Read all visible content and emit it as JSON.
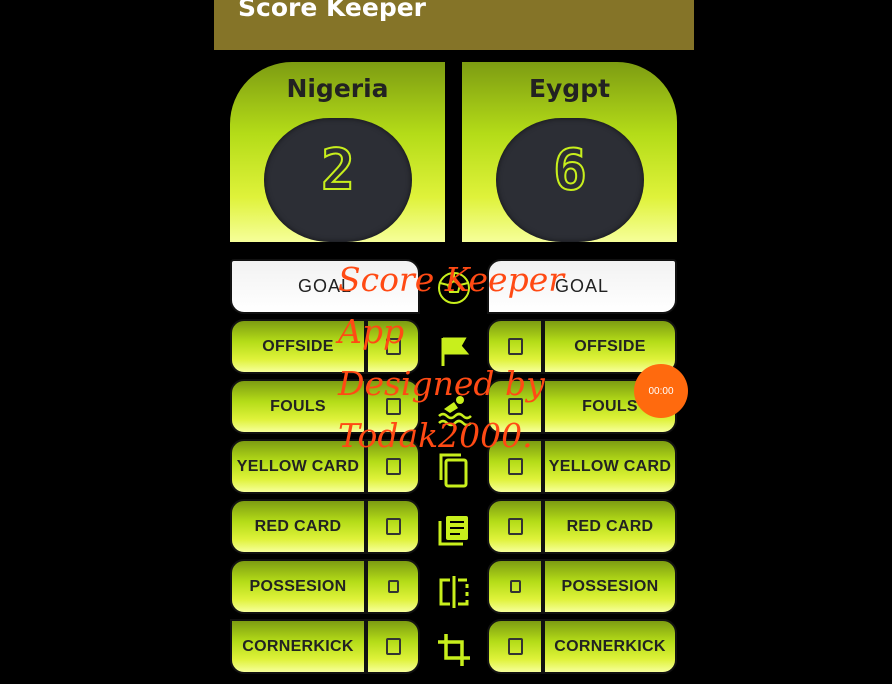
{
  "app": {
    "title": "Score Keeper"
  },
  "teams": [
    {
      "name": "Nigeria",
      "score": "2"
    },
    {
      "name": "Eygpt",
      "score": "6"
    }
  ],
  "actions": [
    {
      "label": "GOAL",
      "left_count": "",
      "right_count": "",
      "icon": "soccer-ball-icon"
    },
    {
      "label": "OFFSIDE",
      "left_count": "0",
      "right_count": "0",
      "icon": "flag-icon"
    },
    {
      "label": "FOULS",
      "left_count": "0",
      "right_count": "0",
      "icon": "swimmer-icon"
    },
    {
      "label": "YELLOW CARD",
      "left_count": "0",
      "right_count": "0",
      "icon": "cards-icon"
    },
    {
      "label": "RED CARD",
      "left_count": "0",
      "right_count": "0",
      "icon": "notes-icon"
    },
    {
      "label": "POSSESION",
      "left_count": "0",
      "right_count": "0",
      "icon": "split-icon"
    },
    {
      "label": "CORNERKICK",
      "left_count": "0",
      "right_count": "0",
      "icon": "crop-icon"
    }
  ],
  "overlay_text": {
    "line1": "Score Keeper",
    "line2": "App",
    "line3": "Designed by",
    "line4": "Todak2000."
  },
  "timer": "00:00",
  "colors": {
    "appbar": "#857428",
    "accent": "#c8ef1c",
    "overlay": "#ff4a14"
  }
}
